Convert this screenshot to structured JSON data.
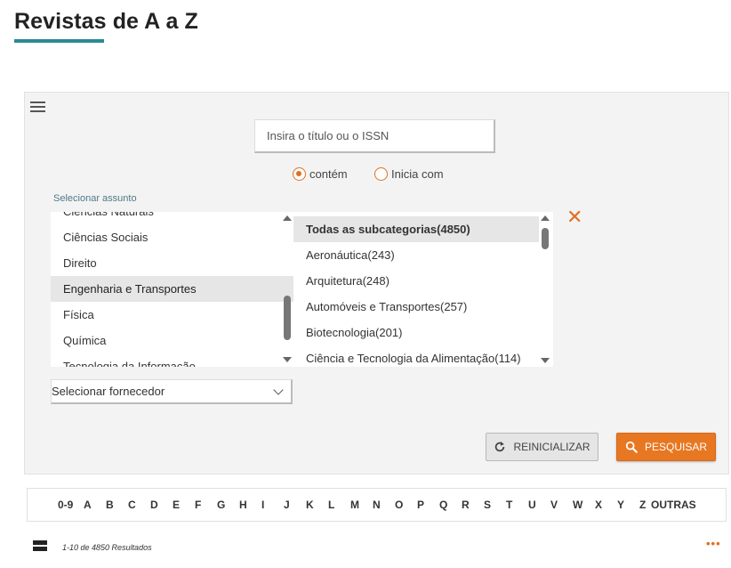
{
  "page": {
    "title": "Revistas de A a Z"
  },
  "search": {
    "placeholder": "Insira o título ou o ISSN",
    "value": ""
  },
  "search_mode": {
    "options": [
      {
        "label": "contém",
        "checked": true
      },
      {
        "label": "Inicia com",
        "checked": false
      }
    ]
  },
  "subject": {
    "label": "Selecionar assunto",
    "categories": [
      {
        "label": "Ciências Naturais",
        "selected": false
      },
      {
        "label": "Ciências Sociais",
        "selected": false
      },
      {
        "label": "Direito",
        "selected": false
      },
      {
        "label": "Engenharia e Transportes",
        "selected": true
      },
      {
        "label": "Física",
        "selected": false
      },
      {
        "label": "Química",
        "selected": false
      },
      {
        "label": "Tecnologia da Informação",
        "selected": false
      }
    ],
    "subcategories": [
      {
        "label": "Todas as subcategorias(4850)",
        "selected": true
      },
      {
        "label": "Aeronáutica(243)",
        "selected": false
      },
      {
        "label": "Arquitetura(248)",
        "selected": false
      },
      {
        "label": "Automóveis e Transportes(257)",
        "selected": false
      },
      {
        "label": "Biotecnologia(201)",
        "selected": false
      },
      {
        "label": "Ciência e Tecnologia da Alimentação(114)",
        "selected": false
      }
    ],
    "clear_icon": "close-icon"
  },
  "supplier": {
    "selected": "Selecionar fornecedor"
  },
  "actions": {
    "reset_label": "REINICIALIZAR",
    "search_label": "PESQUISAR"
  },
  "az": [
    "0-9",
    "A",
    "B",
    "C",
    "D",
    "E",
    "F",
    "G",
    "H",
    "I",
    "J",
    "K",
    "L",
    "M",
    "N",
    "O",
    "P",
    "Q",
    "R",
    "S",
    "T",
    "U",
    "V",
    "W",
    "X",
    "Y",
    "Z",
    "OUTRAS"
  ],
  "results": {
    "count_text": "1-10 de 4850 Resultados"
  },
  "colors": {
    "accent": "#e87722",
    "title_underline": "#2a8a96"
  }
}
